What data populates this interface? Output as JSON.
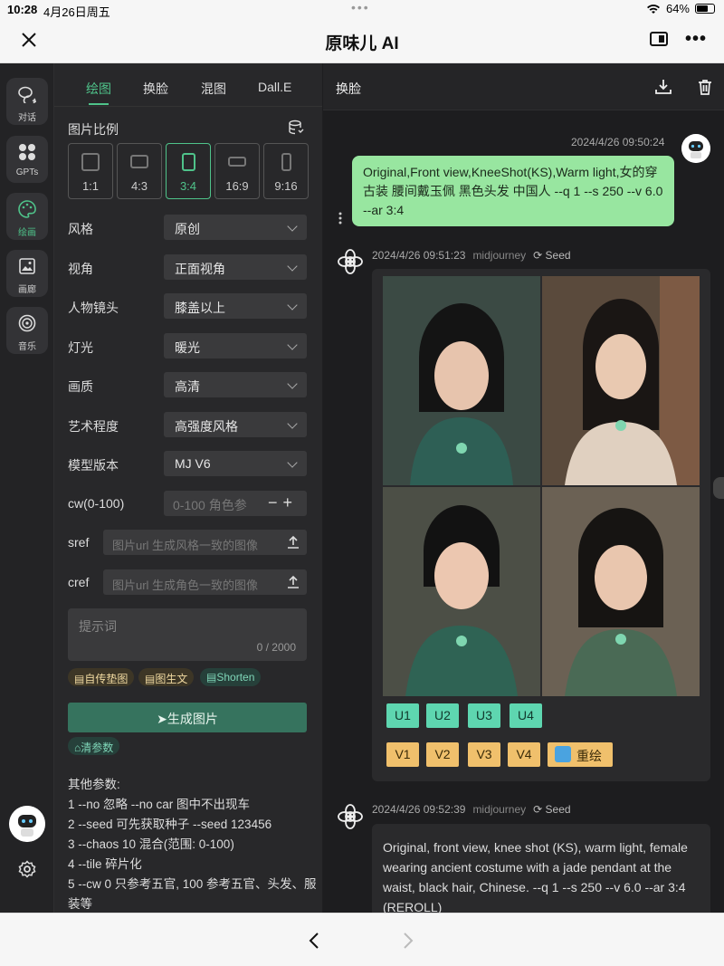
{
  "status": {
    "time": "10:28",
    "date": "4月26日周五",
    "battery": "64%",
    "battery_level": 0.64
  },
  "app": {
    "title": "原味儿 AI"
  },
  "rail": [
    {
      "label": "对话",
      "icon": "chat-bubbles-icon"
    },
    {
      "label": "GPTs",
      "icon": "grid-icon"
    },
    {
      "label": "绘画",
      "icon": "palette-icon",
      "active": true
    },
    {
      "label": "画廊",
      "icon": "gallery-icon"
    },
    {
      "label": "音乐",
      "icon": "music-icon"
    }
  ],
  "tabs": [
    "绘图",
    "换脸",
    "混图",
    "Dall.E"
  ],
  "active_tab": "绘图",
  "ratio_section": {
    "label": "图片比例",
    "options": [
      "1:1",
      "4:3",
      "3:4",
      "16:9",
      "9:16"
    ],
    "selected": "3:4"
  },
  "settings": [
    {
      "label": "风格",
      "value": "原创"
    },
    {
      "label": "视角",
      "value": "正面视角"
    },
    {
      "label": "人物镜头",
      "value": "膝盖以上"
    },
    {
      "label": "灯光",
      "value": "暖光"
    },
    {
      "label": "画质",
      "value": "高清"
    },
    {
      "label": "艺术程度",
      "value": "高强度风格"
    },
    {
      "label": "模型版本",
      "value": "MJ V6"
    }
  ],
  "cw": {
    "label": "cw(0-100)",
    "placeholder": "0-100 角色参"
  },
  "sref": {
    "label": "sref",
    "placeholder": "图片url 生成风格一致的图像"
  },
  "cref": {
    "label": "cref",
    "placeholder": "图片url 生成角色一致的图像"
  },
  "prompt": {
    "placeholder": "提示词",
    "counter": "0 / 2000"
  },
  "chips": [
    "自传垫图",
    "图生文",
    "Shorten"
  ],
  "generate_label": "生成图片",
  "clear_label": "清参数",
  "params": [
    "其他参数:",
    "1 --no 忽略 --no car 图中不出现车",
    "2 --seed 可先获取种子 --seed 123456",
    "3 --chaos 10 混合(范围: 0-100)",
    "4 --tile 碎片化",
    "5 --cw 0 只参考五官, 100 参考五官、头发、服装等"
  ],
  "chat": {
    "header": "换脸",
    "user_msg": {
      "time": "2024/4/26 09:50:24",
      "text": "Original,Front view,KneeShot(KS),Warm light,女的穿古装 腰间戴玉佩 黑色头发 中国人  --q 1 --s 250  --v 6.0 --ar 3:4"
    },
    "bot_msg_1": {
      "time": "2024/4/26 09:51:23",
      "source": "midjourney",
      "seed": "Seed"
    },
    "u_buttons": [
      "U1",
      "U2",
      "U3",
      "U4"
    ],
    "v_buttons": [
      "V1",
      "V2",
      "V3",
      "V4"
    ],
    "redraw_label": "重绘",
    "bot_msg_2": {
      "time": "2024/4/26 09:52:39",
      "source": "midjourney",
      "seed": "Seed",
      "text": "Original, front view, knee shot (KS), warm light, female wearing ancient costume with a jade pendant at the waist, black hair, Chinese.  --q 1 --s 250  --v 6.0 --ar 3:4 (REROLL)"
    }
  },
  "colors": {
    "accent": "#4fc38a",
    "user_bubble": "#98e6a0",
    "u_button": "#5ed6b0",
    "v_button": "#f0c06c",
    "generate": "#36735e"
  }
}
